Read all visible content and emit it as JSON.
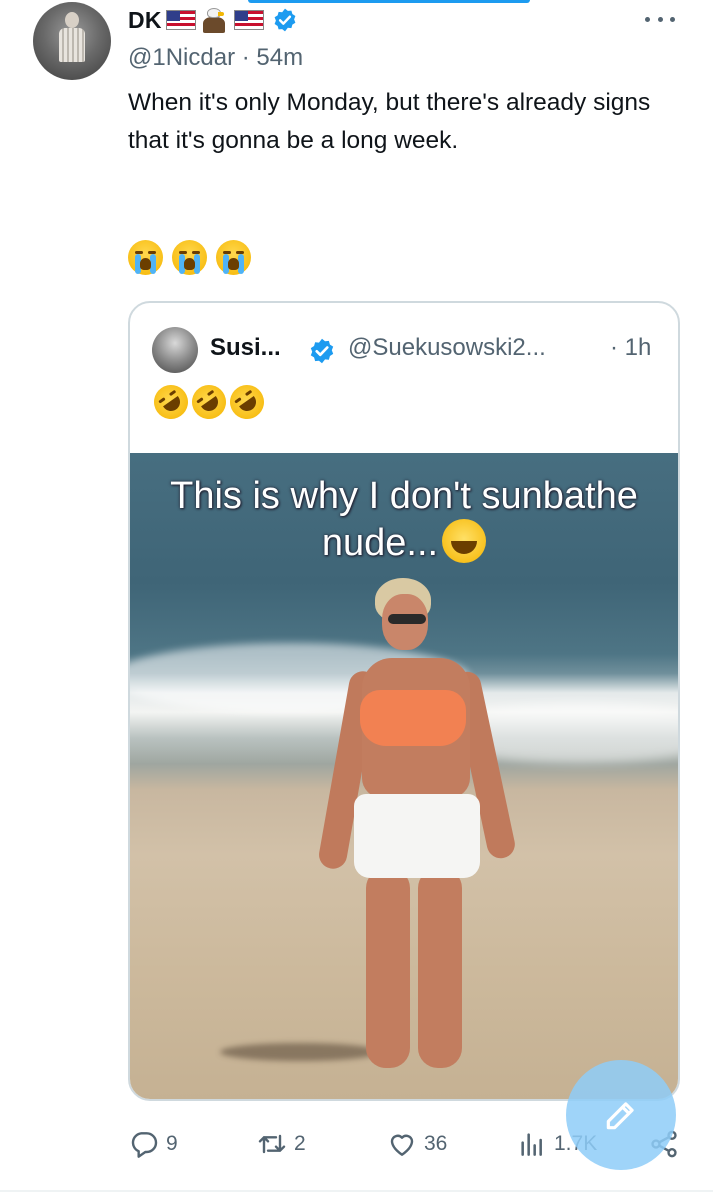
{
  "tweet": {
    "author": {
      "display_name": "DK",
      "handle": "@1Nicdar",
      "time": "54m"
    },
    "text": "When it's only Monday, but there's already signs that it's gonna be a long week.",
    "emoji_count": 3
  },
  "quote": {
    "author": {
      "display_name": "Susi...",
      "handle": "@Suekusowski2...",
      "time": "1h"
    },
    "image_caption": "This is why I don't sunbathe nude..."
  },
  "actions": {
    "replies": "9",
    "retweets": "2",
    "likes": "36",
    "views": "1.7K"
  },
  "colors": {
    "accent": "#1d9bf0",
    "muted_text": "#536471",
    "text": "#0f1419",
    "border": "#cfd9de"
  },
  "icons": {
    "header": [
      "more-icon",
      "verified-badge-icon",
      "us-flag-icon",
      "eagle-icon"
    ],
    "actions": [
      "reply-icon",
      "retweet-icon",
      "like-icon",
      "views-icon",
      "share-icon"
    ],
    "fab": "compose-icon"
  }
}
